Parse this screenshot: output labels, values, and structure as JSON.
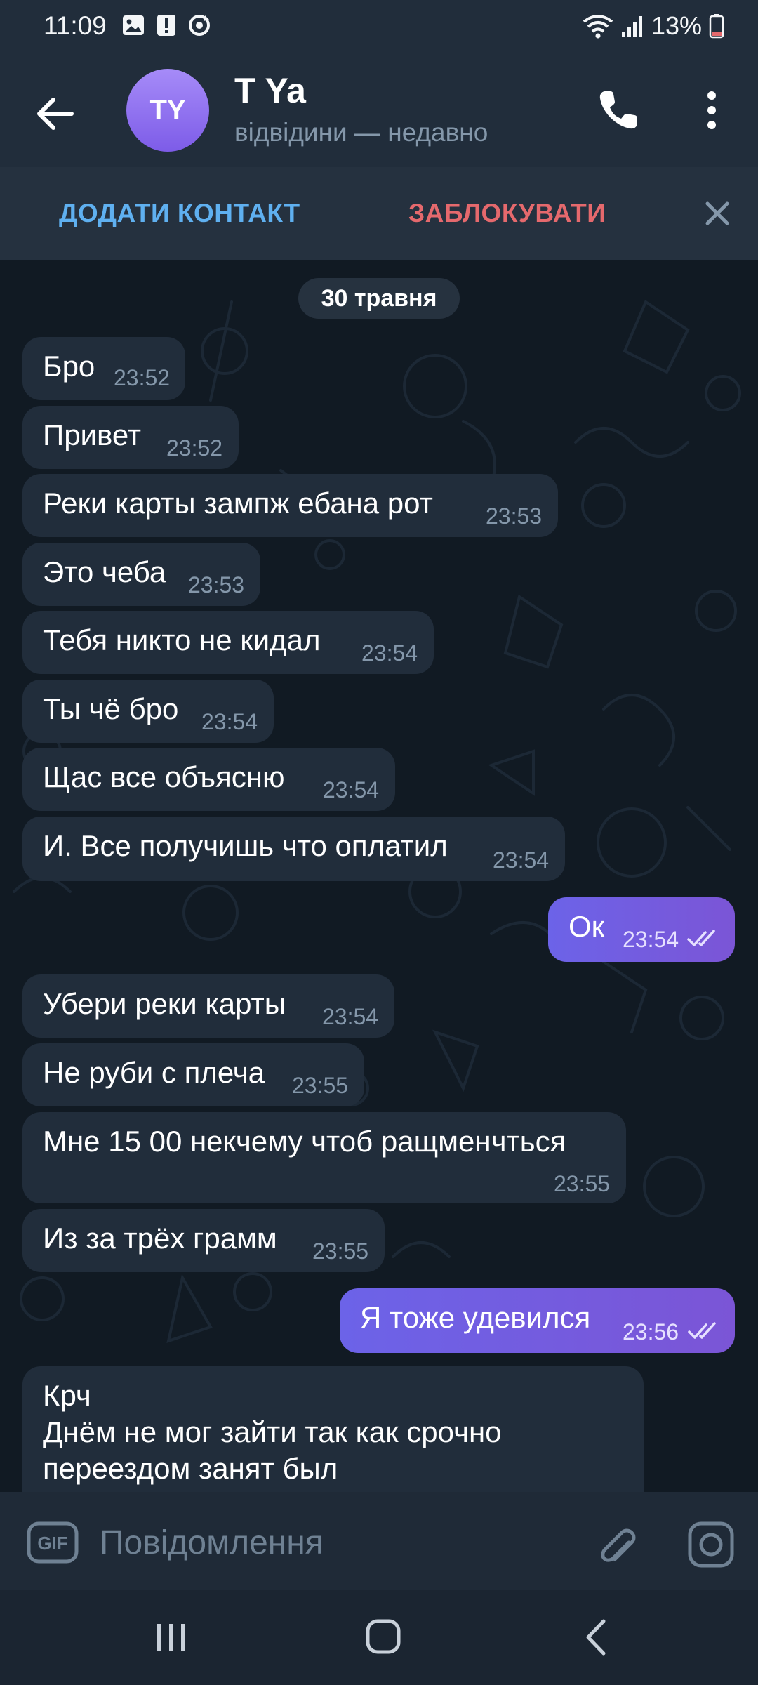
{
  "status_bar": {
    "time": "11:09",
    "battery_percent": "13%",
    "icons": [
      "image-icon",
      "alert-icon",
      "sync-icon",
      "wifi-icon",
      "signal-icon",
      "battery-icon"
    ]
  },
  "header": {
    "avatar_initials": "TY",
    "contact_name": "T Ya",
    "last_seen": "відвідини — недавно",
    "avatar_color": "#8a6cf0"
  },
  "action_bar": {
    "add_contact": "ДОДАТИ КОНТАКТ",
    "block": "ЗАБЛОКУВАТИ",
    "add_color": "#5fb0f0",
    "block_color": "#e5696d"
  },
  "chat": {
    "date": "30 травня",
    "messages": [
      {
        "dir": "in",
        "text": "Бро",
        "time": "23:52"
      },
      {
        "dir": "in",
        "text": "Привет",
        "time": "23:52"
      },
      {
        "dir": "in",
        "text": "Реки карты зампж ебана рот",
        "time": "23:53"
      },
      {
        "dir": "in",
        "text": "Это чеба",
        "time": "23:53"
      },
      {
        "dir": "in",
        "text": "Тебя никто не кидал",
        "time": "23:54"
      },
      {
        "dir": "in",
        "text": "Ты чё бро",
        "time": "23:54"
      },
      {
        "dir": "in",
        "text": "Щас все объясню",
        "time": "23:54"
      },
      {
        "dir": "in",
        "text": "И. Все получишь что оплатил",
        "time": "23:54"
      },
      {
        "dir": "out",
        "text": "Ок",
        "time": "23:54",
        "read": true
      },
      {
        "dir": "in",
        "text": "Убери реки карты",
        "time": "23:54"
      },
      {
        "dir": "in",
        "text": "Не руби с плеча",
        "time": "23:55"
      },
      {
        "dir": "in",
        "text": "Мне 15 00 некчему чтоб ращменчться",
        "time": "23:55"
      },
      {
        "dir": "in",
        "text": "Из за трёх грамм",
        "time": "23:55"
      },
      {
        "dir": "out",
        "text": "Я тоже удевился",
        "time": "23:56",
        "read": true
      },
      {
        "dir": "in",
        "lines": [
          "Крч",
          "Днём не мог зайти так как срочно",
          "переездом занят был"
        ]
      }
    ],
    "outgoing_color": "#6f5ee6",
    "incoming_color": "#212d3b"
  },
  "input_bar": {
    "placeholder": "Повідомлення"
  }
}
